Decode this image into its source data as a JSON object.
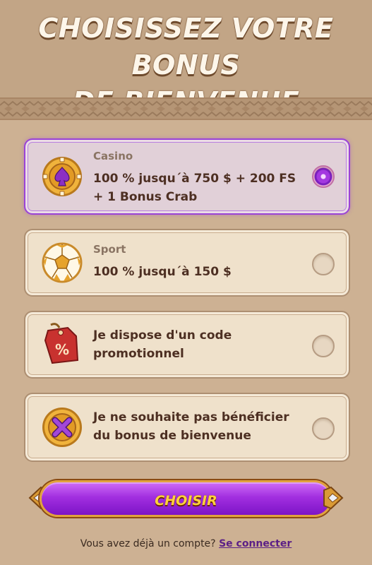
{
  "header": {
    "title_line1": "CHOISISSEZ VOTRE BONUS",
    "title_line2": "DE BIENVENUE"
  },
  "options": [
    {
      "category": "Casino",
      "text": "100 % jusqu´à 750 $ + 200 FS + 1 Bonus Crab",
      "icon": "casino-spade-coin-icon",
      "selected": true
    },
    {
      "category": "Sport",
      "text": "100 % jusqu´à 150 $",
      "icon": "soccer-ball-icon",
      "selected": false
    },
    {
      "category": "",
      "text": "Je dispose d'un code promotionnel",
      "icon": "percent-tag-icon",
      "selected": false
    },
    {
      "category": "",
      "text": "Je ne souhaite pas bénéficier du bonus de bienvenue",
      "icon": "cross-coin-icon",
      "selected": false
    }
  ],
  "cta": {
    "label": "CHOISIR"
  },
  "footer": {
    "question": "Vous avez déjà un compte?",
    "link": "Se connecter"
  },
  "colors": {
    "accent": "#a22fe0",
    "cta_text": "#ffd23c",
    "background": "#cdb193"
  }
}
